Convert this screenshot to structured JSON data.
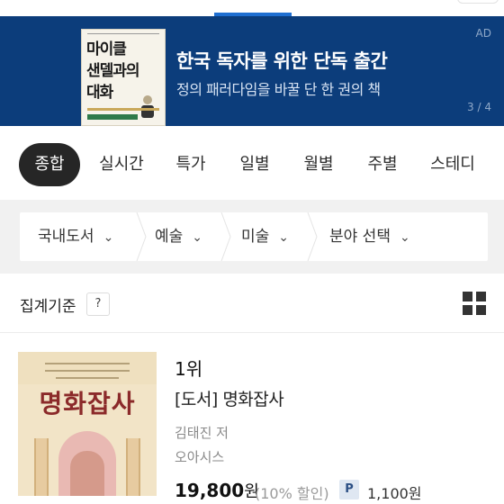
{
  "banner": {
    "ad_label": "AD",
    "title": "한국 독자를 위한 단독 출간",
    "subtitle": "정의 패러다임을 바꿀 단 한 권의 책",
    "page_indicator": "3 / 4",
    "cover_title_lines": [
      "마이클",
      "샌델과의",
      "대화"
    ],
    "background_color": "#0c3d7b"
  },
  "tabs": [
    {
      "label": "종합",
      "active": true
    },
    {
      "label": "실시간",
      "active": false
    },
    {
      "label": "특가",
      "active": false
    },
    {
      "label": "일별",
      "active": false
    },
    {
      "label": "월별",
      "active": false
    },
    {
      "label": "주별",
      "active": false
    },
    {
      "label": "스테디",
      "active": false
    }
  ],
  "filters": [
    {
      "label": "국내도서"
    },
    {
      "label": "예술"
    },
    {
      "label": "미술"
    },
    {
      "label": "분야 선택"
    }
  ],
  "criteria": {
    "label": "집계기준",
    "help": "?"
  },
  "item": {
    "rank": "1위",
    "title": "[도서] 명화잡사",
    "author": "김태진 저",
    "publisher": "오아시스",
    "price": "19,800",
    "price_unit": "원",
    "discount": "(10% 할인)",
    "point_badge": "P",
    "points": "1,100원",
    "cover_title": "명화잡사"
  },
  "icons": {
    "filter_chevron": "chevron-down-icon",
    "view_toggle": "grid-view-icon"
  }
}
